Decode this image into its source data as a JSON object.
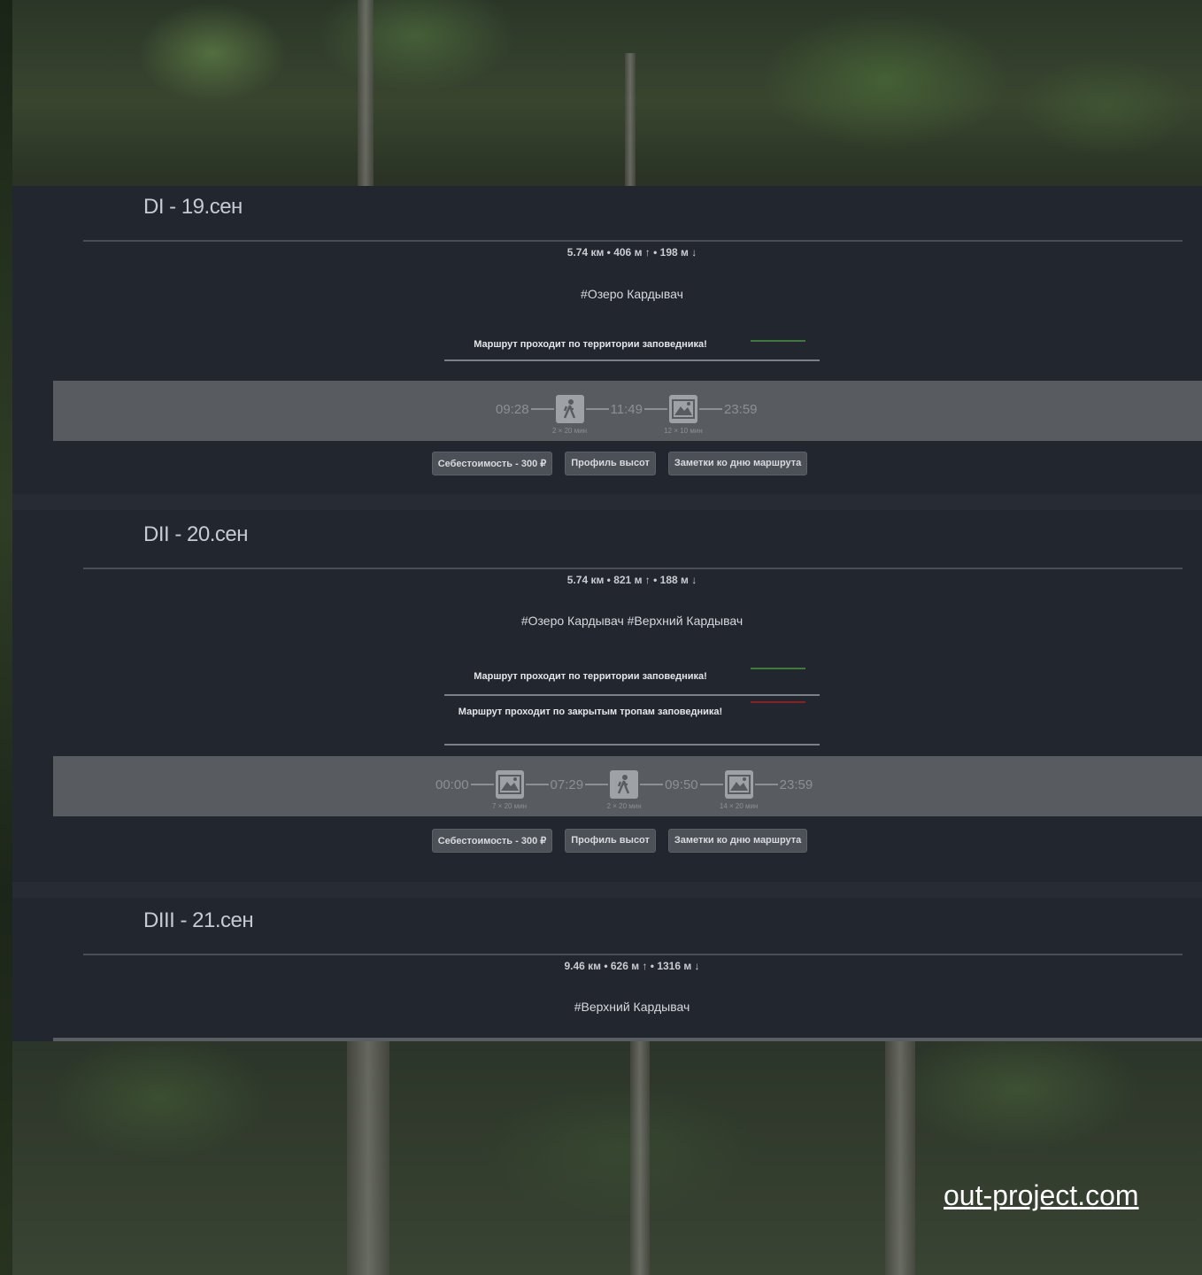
{
  "days": [
    {
      "title": "DI - 19.сен",
      "stats": "5.74 км • 406 м ↑ • 198 м ↓",
      "tags": "#Озеро Кардывач",
      "warnings": [
        {
          "text": "Маршрут проходит по территории заповедника!",
          "color": "#3f7a3a"
        }
      ],
      "timeline": [
        {
          "type": "time",
          "value": "09:28"
        },
        {
          "type": "node",
          "icon": "hiker-icon",
          "sub": "2 × 20 мин"
        },
        {
          "type": "time",
          "value": "11:49"
        },
        {
          "type": "node",
          "icon": "landscape-icon",
          "sub": "12 × 10 мин"
        },
        {
          "type": "time",
          "value": "23:59"
        }
      ],
      "buttons": [
        "Себестоимость - 300 ₽",
        "Профиль высот",
        "Заметки ко дню маршрута"
      ]
    },
    {
      "title": "DII - 20.сен",
      "stats": "5.74 км • 821 м ↑ • 188 м ↓",
      "tags": "#Озеро Кардывач #Верхний Кардывач",
      "warnings": [
        {
          "text": "Маршрут проходит по территории заповедника!",
          "color": "#3f7a3a"
        },
        {
          "text": "Маршрут проходит по закрытым тропам заповедника!",
          "color": "#8a2222"
        }
      ],
      "timeline": [
        {
          "type": "time",
          "value": "00:00"
        },
        {
          "type": "node",
          "icon": "landscape-icon",
          "sub": "7 × 20 мин"
        },
        {
          "type": "time",
          "value": "07:29"
        },
        {
          "type": "node",
          "icon": "hiker-icon",
          "sub": "2 × 20 мин"
        },
        {
          "type": "time",
          "value": "09:50"
        },
        {
          "type": "node",
          "icon": "landscape-icon",
          "sub": "14 × 20 мин"
        },
        {
          "type": "time",
          "value": "23:59"
        }
      ],
      "buttons": [
        "Себестоимость - 300 ₽",
        "Профиль высот",
        "Заметки ко дню маршрута"
      ]
    },
    {
      "title": "DIII - 21.сен",
      "stats": "9.46 км • 626 м ↑ • 1316 м ↓",
      "tags": "#Верхний Кардывач"
    }
  ],
  "footer": {
    "link": "out-project.com"
  }
}
